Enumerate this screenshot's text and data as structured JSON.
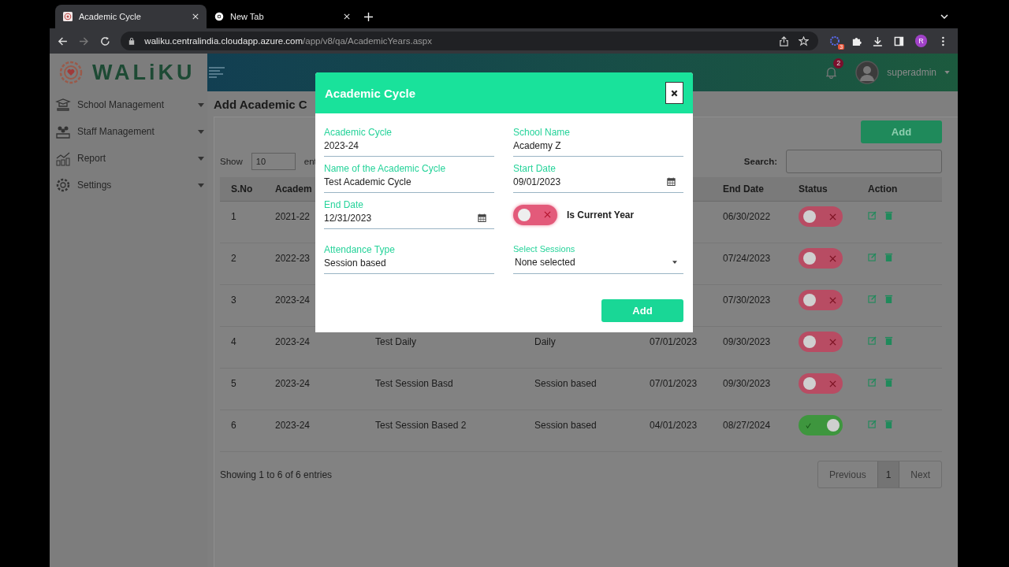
{
  "browser": {
    "tabs": [
      {
        "title": "Academic Cycle",
        "selected": true
      },
      {
        "title": "New Tab",
        "selected": false
      }
    ],
    "url_host": "waliku.centralindia.cloudapp.azure.com",
    "url_path": "/app/v8/qa/AcademicYears.aspx",
    "extension_badge": "3",
    "profile_initial": "R"
  },
  "app": {
    "logo": "WALiKU",
    "notification_count": "2",
    "user": "superadmin"
  },
  "sidebar": {
    "items": [
      {
        "label": "School Management"
      },
      {
        "label": "Staff Management"
      },
      {
        "label": "Report"
      },
      {
        "label": "Settings"
      }
    ]
  },
  "page": {
    "heading": "Add Academic C",
    "add_button": "Add",
    "show_label": "Show",
    "page_length": "10",
    "entries_label": "ent",
    "search_label": "Search:"
  },
  "table": {
    "headers": {
      "sno": "S.No",
      "academic_cycle": "Academ",
      "end_date": "End Date",
      "status": "Status",
      "action": "Action"
    },
    "rows": [
      {
        "sno": "1",
        "academic_cycle": "2021-22",
        "end_date": "06/30/2022",
        "status_on": false
      },
      {
        "sno": "2",
        "academic_cycle": "2022-23",
        "end_date": "07/24/2023",
        "status_on": false
      },
      {
        "sno": "3",
        "academic_cycle": "2023-24",
        "end_date": "07/30/2023",
        "status_on": false
      },
      {
        "sno": "4",
        "academic_cycle": "2023-24",
        "name": "Test Daily",
        "attendance_type": "Daily",
        "start_date": "07/01/2023",
        "end_date": "09/30/2023",
        "status_on": false
      },
      {
        "sno": "5",
        "academic_cycle": "2023-24",
        "name": "Test Session Basd",
        "attendance_type": "Session based",
        "start_date": "07/01/2023",
        "end_date": "09/30/2023",
        "status_on": false
      },
      {
        "sno": "6",
        "academic_cycle": "2023-24",
        "name": "Test Session Based 2",
        "attendance_type": "Session based",
        "start_date": "04/01/2023",
        "end_date": "08/27/2024",
        "status_on": true
      }
    ]
  },
  "footer": {
    "info": "Showing 1 to 6 of 6 entries",
    "previous": "Previous",
    "pages": [
      {
        "label": "1",
        "selected": true
      }
    ],
    "next": "Next"
  },
  "modal": {
    "title": "Academic Cycle",
    "submit": "Add",
    "fields": [
      {
        "kind": "text",
        "label": "Academic Cycle",
        "value": "2023-24"
      },
      {
        "kind": "text",
        "label": "School Name",
        "value": "Academy Z"
      },
      {
        "kind": "text",
        "label": "Name of the Academic Cycle",
        "value": "Test Academic Cycle"
      },
      {
        "kind": "date",
        "label": "Start Date",
        "value": "09/01/2023"
      },
      {
        "kind": "date",
        "label": "End Date",
        "value": "12/31/2023"
      },
      {
        "kind": "toggle",
        "label": "Is Current Year",
        "on": false
      },
      {
        "kind": "text",
        "label": "Attendance Type",
        "value": "Session based"
      },
      {
        "kind": "select",
        "label": "Select Sessions",
        "value": "None selected"
      }
    ]
  }
}
